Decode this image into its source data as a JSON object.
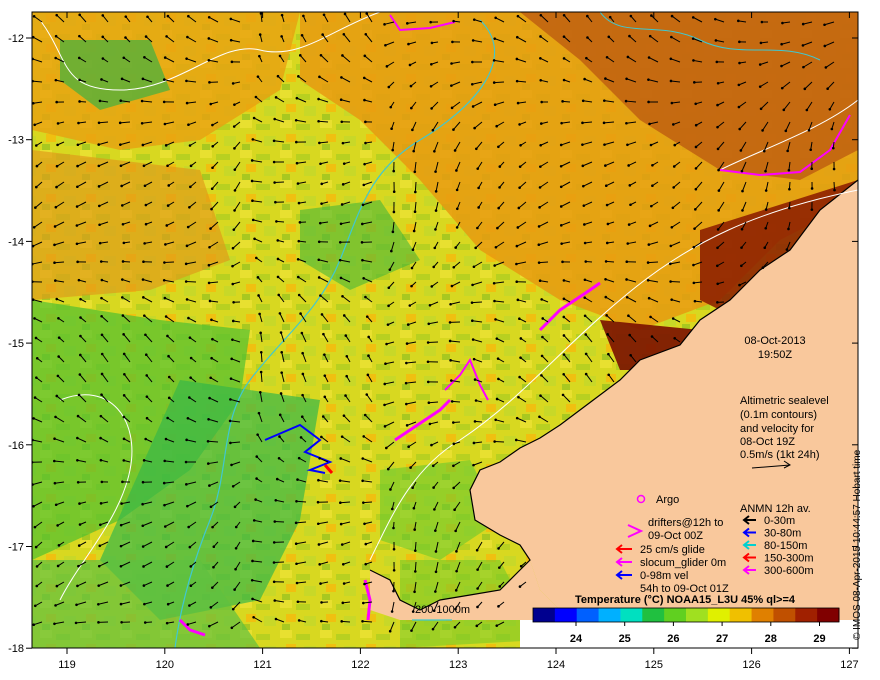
{
  "map": {
    "x_ticks": [
      "119",
      "120",
      "121",
      "122",
      "123",
      "124",
      "125",
      "126",
      "127"
    ],
    "y_ticks": [
      "-12",
      "-13",
      "-14",
      "-15",
      "-16",
      "-17",
      "-18"
    ],
    "date_label": "08-Oct-2013",
    "time_label": "19:50Z",
    "altimetry": {
      "lines": [
        "Altimetric sealevel",
        "(0.1m contours)",
        "and velocity for",
        "08-Oct 19Z",
        "0.5m/s (1kt 24h)"
      ]
    },
    "legend": {
      "argo": "Argo",
      "drifters_line1": "drifters@12h to",
      "drifters_line2": "09-Oct 00Z",
      "glide": "25 cm/s glide",
      "slocum": "slocum_glider 0m",
      "vel_line1": "0-98m vel",
      "vel_line2": "54h to 09-Oct 01Z",
      "anmn_title": "ANMN 12h av.",
      "anmn": [
        {
          "label": "0-30m",
          "color": "#000000"
        },
        {
          "label": "30-80m",
          "color": "#0000ff"
        },
        {
          "label": "80-150m",
          "color": "#00d0d0"
        },
        {
          "label": "150-300m",
          "color": "#ff0000"
        },
        {
          "label": "300-600m",
          "color": "#ff00ff"
        }
      ]
    },
    "depth_contours": "200  1000m",
    "colorbar": {
      "title": "Temperature (°C) NOAA15_L3U 45% ql>=4",
      "ticks": [
        "24",
        "25",
        "26",
        "27",
        "28",
        "29"
      ],
      "colors": [
        "#00008f",
        "#0000ff",
        "#0060ff",
        "#00b0ff",
        "#00e0c0",
        "#20c040",
        "#60d020",
        "#a0e020",
        "#e0f000",
        "#f0c000",
        "#e08000",
        "#c05000",
        "#a02000",
        "#800000"
      ]
    },
    "credit": "© IMOS 08-Apr-2015 10:44:57 Hobart time",
    "colors": {
      "land": "#f9c89c",
      "drifter": "#ff00ff",
      "glider": "#0000ff",
      "contour_200": "#40c8d0",
      "contour_sealevel": "#ffffff"
    }
  }
}
